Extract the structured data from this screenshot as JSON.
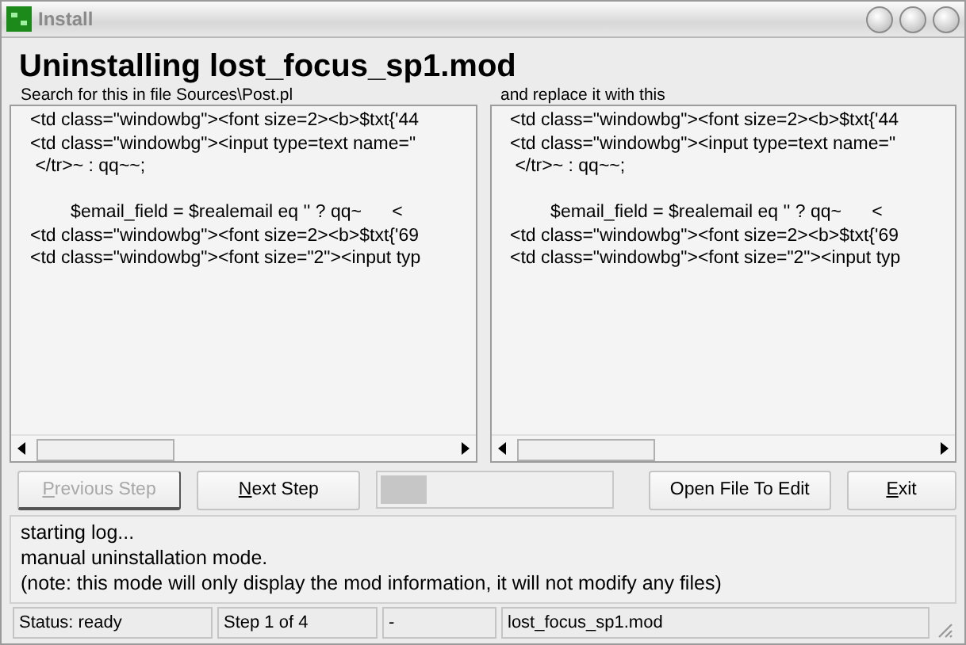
{
  "window": {
    "title": "Install"
  },
  "heading": "Uninstalling lost_focus_sp1.mod",
  "panes": [
    {
      "label": "Search for this in file Sources\\Post.pl",
      "blocks": [
        [
          "<td class=\"windowbg\"><font size=2><b>$txt{'44",
          "<td class=\"windowbg\"><input type=text name=\"",
          " </tr>~ : qq~~;"
        ],
        [
          "        $email_field = $realemail eq '' ? qq~      <",
          "<td class=\"windowbg\"><font size=2><b>$txt{'69",
          "<td class=\"windowbg\"><font size=\"2\"><input typ"
        ]
      ]
    },
    {
      "label": "and replace it with this",
      "blocks": [
        [
          "<td class=\"windowbg\"><font size=2><b>$txt{'44",
          "<td class=\"windowbg\"><input type=text name=\"",
          " </tr>~ : qq~~;"
        ],
        [
          "        $email_field = $realemail eq '' ? qq~      <",
          "<td class=\"windowbg\"><font size=2><b>$txt{'69",
          "<td class=\"windowbg\"><font size=\"2\"><input typ"
        ]
      ]
    }
  ],
  "buttons": [
    {
      "label": "Previous Step",
      "disabled": true,
      "mnemonic": true
    },
    {
      "label": "Next Step",
      "disabled": false,
      "mnemonic": true
    }
  ],
  "progress": {
    "level": 0.22
  },
  "buttons_right": [
    {
      "label": "Open File To Edit",
      "disabled": false,
      "mnemonic": false
    },
    {
      "label": "Exit",
      "disabled": false,
      "mnemonic": true
    }
  ],
  "log": [
    "starting log...",
    "manual uninstallation mode.",
    "(note: this mode will only display the mod information, it will not modify any files)"
  ],
  "status_bar": [
    "Status: ready",
    "Step 1 of 4",
    "-",
    "lost_focus_sp1.mod"
  ]
}
